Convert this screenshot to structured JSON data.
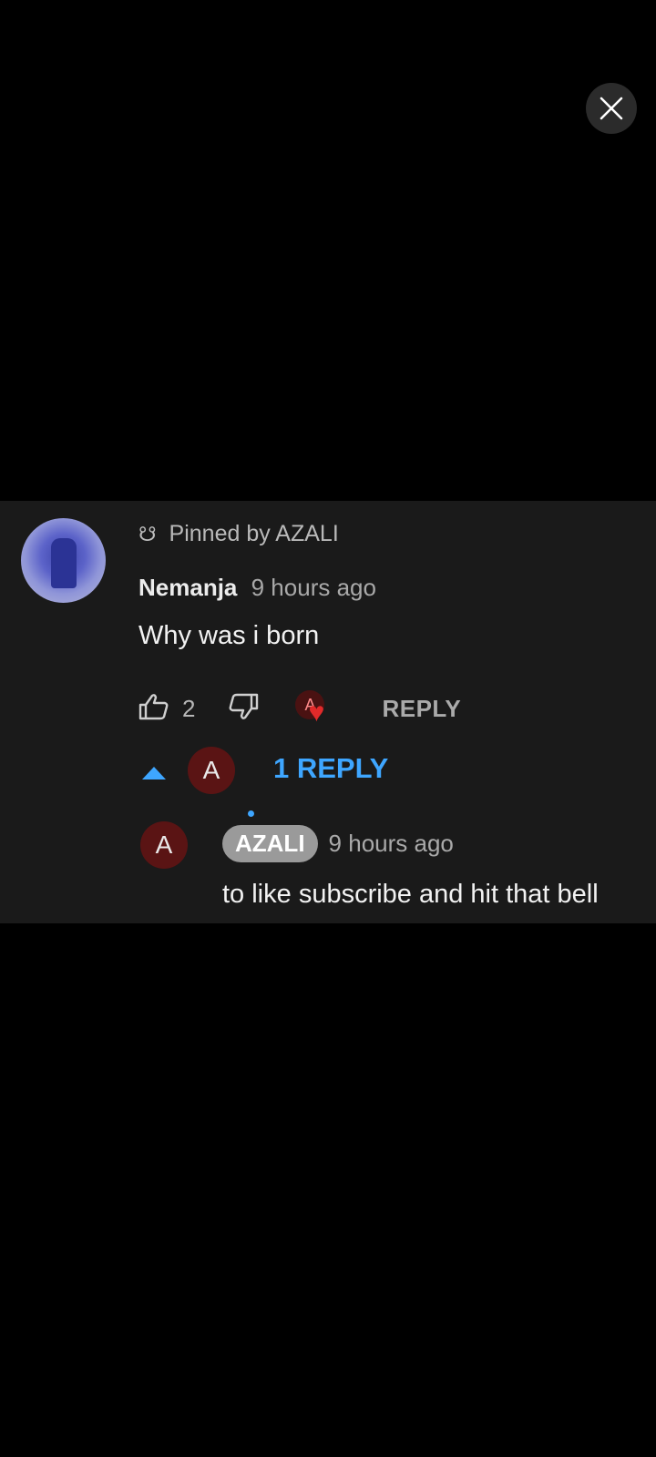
{
  "comment": {
    "pinned_label": "Pinned by AZALI",
    "author": "Nemanja",
    "time": "9 hours ago",
    "text": "Why was i born",
    "like_count": "2",
    "heart_avatar_letter": "A",
    "reply_label": "REPLY",
    "replies_toggle_label": "1 REPLY",
    "replies_avatar_letter": "A"
  },
  "reply": {
    "avatar_letter": "A",
    "author": "AZALI",
    "time": "9 hours ago",
    "text": "to like subscribe and hit that bell"
  },
  "colors": {
    "link": "#3ea6ff",
    "heart": "#e22a2a",
    "panel": "#1a1a1a"
  }
}
